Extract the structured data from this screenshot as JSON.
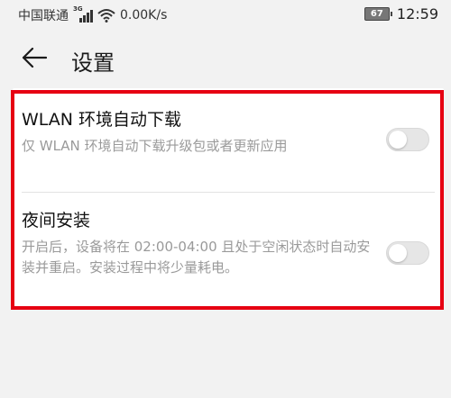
{
  "status_bar": {
    "carrier": "中国联通",
    "network_type": "3G",
    "speed": "0.00K/s",
    "battery": "67",
    "time": "12:59"
  },
  "header": {
    "back_icon": "arrow-left-icon",
    "title": "设置"
  },
  "settings": [
    {
      "title": "WLAN 环境自动下载",
      "description": "仅 WLAN 环境自动下载升级包或者更新应用",
      "enabled": false
    },
    {
      "title": "夜间安装",
      "description": "开启后，设备将在 02:00-04:00 且处于空闲状态时自动安装并重启。安装过程中将少量耗电。",
      "enabled": false
    }
  ],
  "colors": {
    "background": "#f2f2f2",
    "card": "#ffffff",
    "highlight_border": "#e60012",
    "secondary_text": "#9a9a9a"
  }
}
